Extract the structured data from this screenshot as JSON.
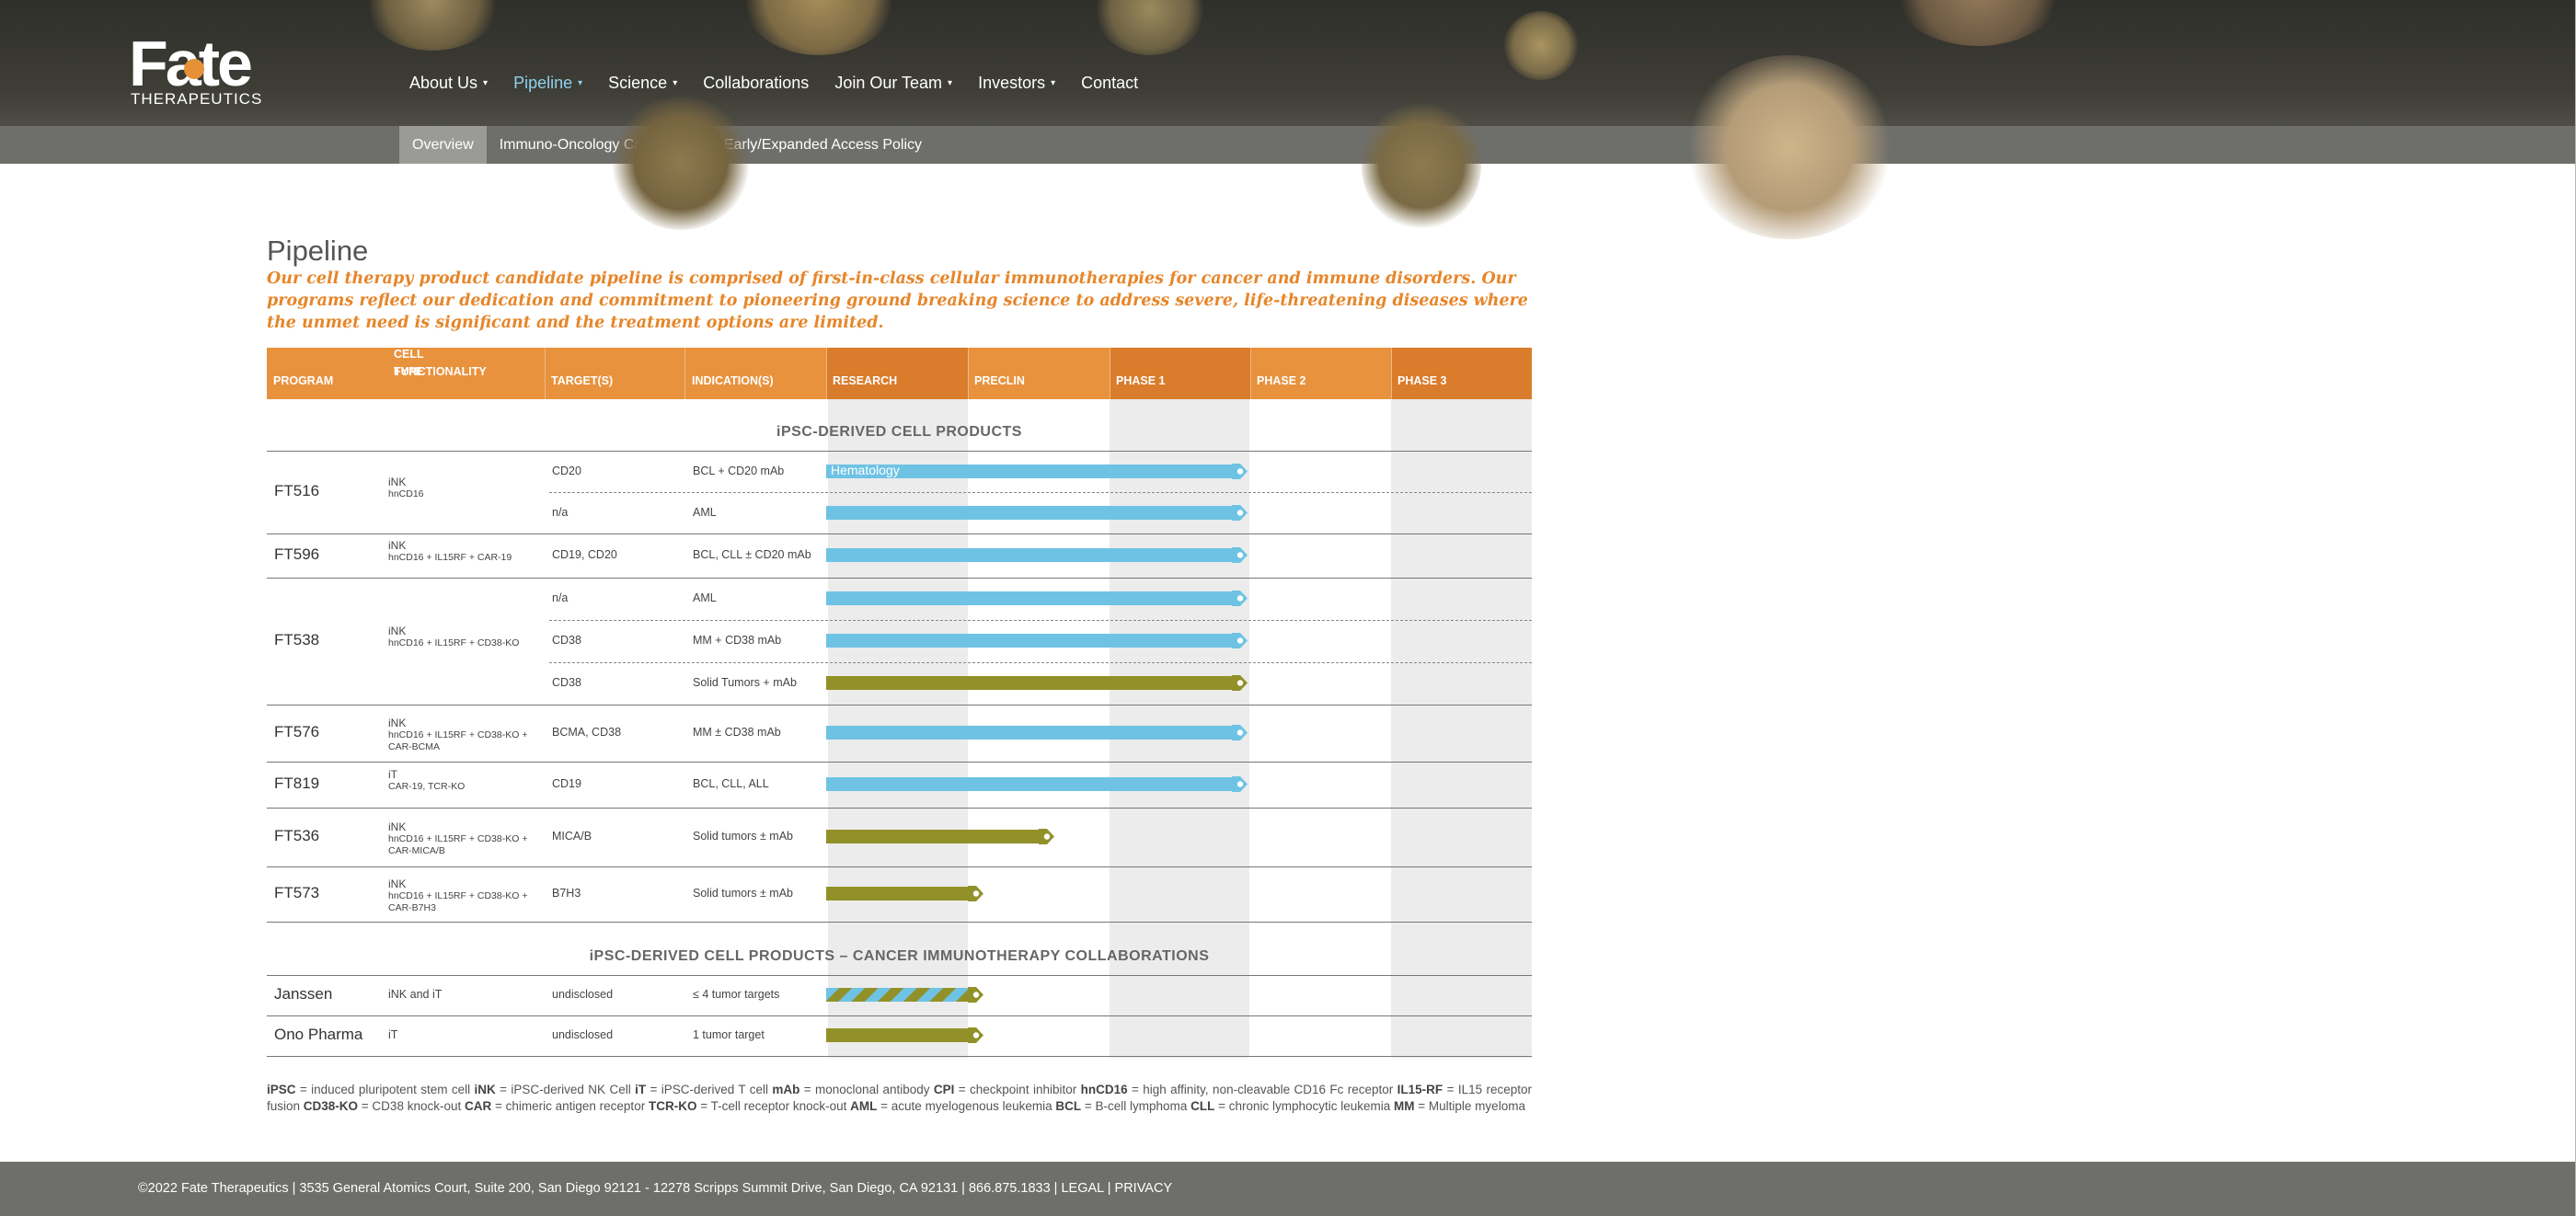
{
  "brand": {
    "logo_word": "Fate",
    "logo_sub": "THERAPEUTICS",
    "accent_color": "#e6862a",
    "link_color": "#8fd1ee"
  },
  "nav": {
    "items": [
      {
        "label": "About Us",
        "has_caret": true,
        "active": false
      },
      {
        "label": "Pipeline",
        "has_caret": true,
        "active": true
      },
      {
        "label": "Science",
        "has_caret": true,
        "active": false
      },
      {
        "label": "Collaborations",
        "has_caret": false,
        "active": false
      },
      {
        "label": "Join Our Team",
        "has_caret": true,
        "active": false
      },
      {
        "label": "Investors",
        "has_caret": true,
        "active": false
      },
      {
        "label": "Contact",
        "has_caret": false,
        "active": false
      }
    ]
  },
  "subnav": {
    "items": [
      {
        "label": "Overview",
        "active": true
      },
      {
        "label": "Immuno-Oncology Candidates",
        "active": false
      },
      {
        "label": "Early/Expanded Access Policy",
        "active": false
      }
    ]
  },
  "page": {
    "title": "Pipeline",
    "intro": "Our cell therapy product candidate pipeline is comprised of first-in-class cellular immunotherapies for cancer and immune disorders. Our programs reflect our dedication and commitment to pioneering ground breaking science to address severe, life-threatening diseases where the unmet need is significant and the treatment options are limited."
  },
  "table": {
    "headers": {
      "program": "PROGRAM",
      "celltype_1": "CELL TYPE",
      "celltype_2": "FUNCTIONALITY",
      "targets": "TARGET(S)",
      "indications": "INDICATION(S)",
      "research": "RESEARCH",
      "preclin": "PRECLIN",
      "phase1": "PHASE 1",
      "phase2": "PHASE 2",
      "phase3": "PHASE 3"
    },
    "section1_title": "iPSC-DERIVED CELL PRODUCTS",
    "section2_title": "iPSC-DERIVED CELL PRODUCTS – CANCER IMMUNOTHERAPY COLLABORATIONS",
    "hematology_label": "Hematology",
    "programs": [
      {
        "program": "FT516",
        "cell_type": "iNK",
        "functionality": "hnCD16",
        "rows": [
          {
            "target": "CD20",
            "indication": "BCL + CD20 mAb",
            "stage": "Phase 1",
            "color": "blue"
          },
          {
            "target": "n/a",
            "indication": "AML",
            "stage": "Phase 1",
            "color": "blue"
          }
        ]
      },
      {
        "program": "FT596",
        "cell_type": "iNK",
        "functionality": "hnCD16 + IL15RF + CAR-19",
        "rows": [
          {
            "target": "CD19, CD20",
            "indication": "BCL, CLL ± CD20 mAb",
            "stage": "Phase 1",
            "color": "blue"
          }
        ]
      },
      {
        "program": "FT538",
        "cell_type": "iNK",
        "functionality": "hnCD16 + IL15RF + CD38-KO",
        "rows": [
          {
            "target": "n/a",
            "indication": "AML",
            "stage": "Phase 1",
            "color": "blue"
          },
          {
            "target": "CD38",
            "indication": "MM + CD38 mAb",
            "stage": "Phase 1",
            "color": "blue"
          },
          {
            "target": "CD38",
            "indication": "Solid Tumors + mAb",
            "stage": "Phase 1",
            "color": "olive"
          }
        ]
      },
      {
        "program": "FT576",
        "cell_type": "iNK",
        "functionality": "hnCD16 + IL15RF + CD38-KO + CAR-BCMA",
        "rows": [
          {
            "target": "BCMA, CD38",
            "indication": "MM ± CD38 mAb",
            "stage": "Phase 1",
            "color": "blue"
          }
        ]
      },
      {
        "program": "FT819",
        "cell_type": "iT",
        "functionality": "CAR-19, TCR-KO",
        "rows": [
          {
            "target": "CD19",
            "indication": "BCL, CLL, ALL",
            "stage": "Phase 1",
            "color": "blue"
          }
        ]
      },
      {
        "program": "FT536",
        "cell_type": "iNK",
        "functionality": "hnCD16 + IL15RF + CD38-KO + CAR-MICA/B",
        "rows": [
          {
            "target": "MICA/B",
            "indication": "Solid tumors ± mAb",
            "stage": "Preclin (late)",
            "color": "olive"
          }
        ]
      },
      {
        "program": "FT573",
        "cell_type": "iNK",
        "functionality": "hnCD16 + IL15RF + CD38-KO + CAR-B7H3",
        "rows": [
          {
            "target": "B7H3",
            "indication": "Solid tumors ± mAb",
            "stage": "Preclin",
            "color": "olive"
          }
        ]
      }
    ],
    "collaborations": [
      {
        "program": "Janssen",
        "cell_type": "iNK and iT",
        "target": "undisclosed",
        "indication": "≤ 4 tumor targets",
        "stage": "Preclin",
        "color": "stripe"
      },
      {
        "program": "Ono Pharma",
        "cell_type": "iT",
        "target": "undisclosed",
        "indication": "1 tumor target",
        "stage": "Preclin",
        "color": "olive"
      }
    ]
  },
  "legend": {
    "entries": [
      [
        "iPSC",
        " = induced pluripotent stem cell "
      ],
      [
        "iNK",
        " = iPSC-derived NK Cell "
      ],
      [
        "iT",
        " = iPSC-derived T cell "
      ],
      [
        "mAb",
        " = monoclonal antibody "
      ],
      [
        "CPI",
        " = checkpoint inhibitor "
      ],
      [
        "hnCD16",
        " = high affinity, non-cleavable CD16 Fc receptor "
      ],
      [
        "IL15-RF",
        " = IL15 receptor fusion "
      ],
      [
        "CD38-KO",
        " = CD38 knock-out "
      ],
      [
        "CAR",
        " = chimeric antigen receptor "
      ],
      [
        "TCR-KO",
        " = T-cell receptor knock-out "
      ],
      [
        "AML",
        " = acute myelogenous leukemia "
      ],
      [
        "BCL",
        " = B-cell lymphoma "
      ],
      [
        "CLL",
        " = chronic lymphocytic leukemia  "
      ],
      [
        "MM",
        " = Multiple myeloma"
      ]
    ]
  },
  "footer": {
    "text": "©2022 Fate Therapeutics | 3535 General Atomics Court, Suite 200, San Diego 92121 - 12278 Scripps Summit Drive, San Diego, CA 92131 | 866.875.1833 | ",
    "legal": "LEGAL",
    "separator": " | ",
    "privacy": "PRIVACY"
  }
}
